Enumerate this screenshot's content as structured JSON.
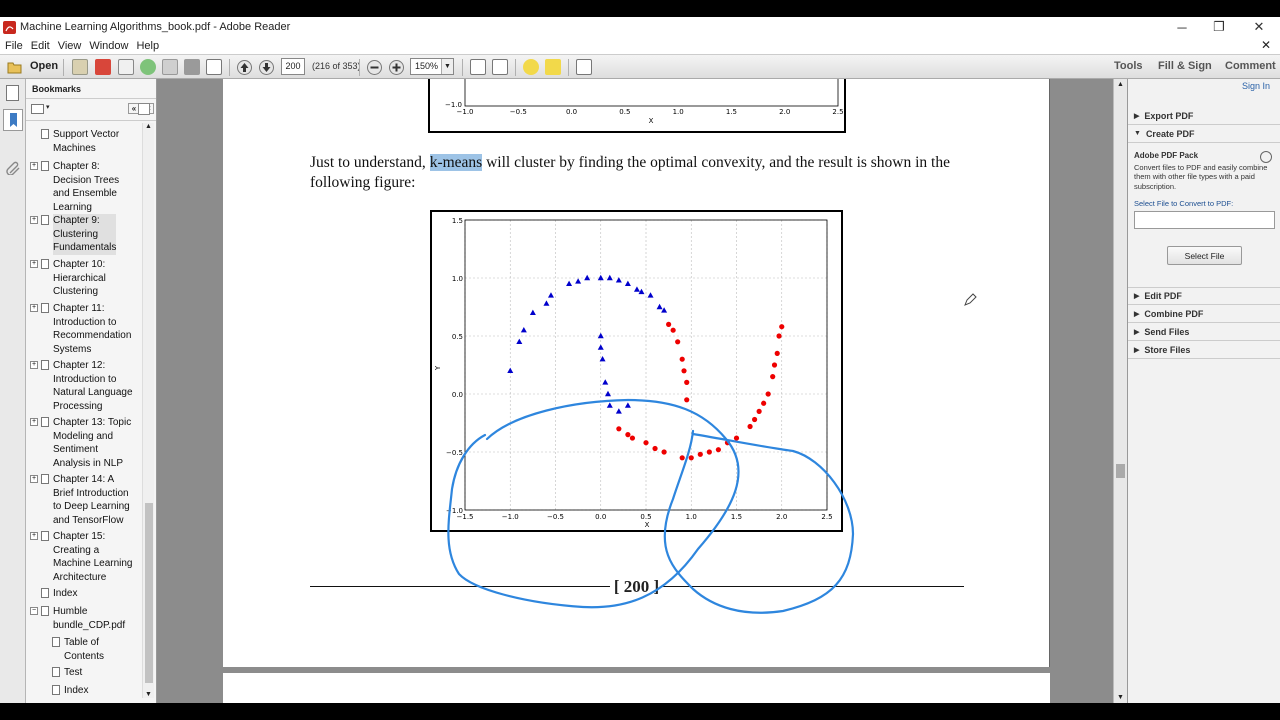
{
  "window": {
    "title": "Machine Learning Algorithms_book.pdf - Adobe Reader",
    "minimize": "─",
    "restore": "❐",
    "close": "✕"
  },
  "menu": {
    "items": [
      "File",
      "Edit",
      "View",
      "Window",
      "Help"
    ],
    "close_doc": "✕"
  },
  "toolbar": {
    "open_label": "Open",
    "page_value": "200",
    "page_count": "(216 of 353)",
    "zoom_value": "150%",
    "tools_label": "Tools",
    "fillsign_label": "Fill & Sign",
    "comment_label": "Comment"
  },
  "bookmarks": {
    "header": "Bookmarks",
    "items": [
      {
        "label": "Support Vector\nMachines",
        "expander": "",
        "selected": false
      },
      {
        "label": "Chapter 8:\nDecision Trees\nand Ensemble\nLearning",
        "expander": "+",
        "selected": false
      },
      {
        "label": "Chapter 9:\nClustering\nFundamentals",
        "expander": "+",
        "selected": true
      },
      {
        "label": "Chapter 10:\nHierarchical\nClustering",
        "expander": "+",
        "selected": false
      },
      {
        "label": "Chapter 11:\nIntroduction to\nRecommendation\nSystems",
        "expander": "+",
        "selected": false
      },
      {
        "label": "Chapter 12:\nIntroduction to\nNatural Language\nProcessing",
        "expander": "+",
        "selected": false
      },
      {
        "label": "Chapter 13: Topic\nModeling and\nSentiment\nAnalysis in NLP",
        "expander": "+",
        "selected": false
      },
      {
        "label": "Chapter 14: A\nBrief Introduction\nto Deep Learning\nand TensorFlow",
        "expander": "+",
        "selected": false
      },
      {
        "label": "Chapter 15:\nCreating a\nMachine Learning\nArchitecture",
        "expander": "+",
        "selected": false
      },
      {
        "label": "Index",
        "expander": "",
        "selected": false
      },
      {
        "label": "Humble\nbundle_CDP.pdf",
        "expander": "−",
        "selected": false
      },
      {
        "label": "Table of\nContents",
        "expander": "",
        "selected": false
      },
      {
        "label": "Test",
        "expander": "",
        "selected": false
      },
      {
        "label": "Index",
        "expander": "",
        "selected": false
      }
    ]
  },
  "document": {
    "para_before": "Just to understand, ",
    "para_highlight": "k-means",
    "para_after": " will cluster by finding the optimal convexity, and the result is shown in the following figure:",
    "page_number": "[ 200 ]"
  },
  "top_figure": {
    "xticks": [
      "−1.0",
      "−0.5",
      "0.0",
      "0.5",
      "1.0",
      "1.5",
      "2.0",
      "2.5"
    ],
    "ytick": "−1.0",
    "xlabel": "X"
  },
  "chart_data": {
    "type": "scatter",
    "xlabel": "X",
    "ylabel": "Y",
    "xlim": [
      -1.5,
      2.5
    ],
    "ylim": [
      -1.0,
      1.5
    ],
    "xticks": [
      "−1.5",
      "−1.0",
      "−0.5",
      "0.0",
      "0.5",
      "1.0",
      "1.5",
      "2.0",
      "2.5"
    ],
    "yticks": [
      "1.5",
      "1.0",
      "0.5",
      "0.0",
      "−0.5",
      "−1.0"
    ],
    "grid": true,
    "series": [
      {
        "color": "#0000cc",
        "marker": "triangle",
        "points": [
          [
            -1.0,
            0.2
          ],
          [
            -0.9,
            0.45
          ],
          [
            -0.75,
            0.7
          ],
          [
            -0.55,
            0.85
          ],
          [
            -0.35,
            0.95
          ],
          [
            -0.15,
            1.0
          ],
          [
            0.0,
            1.0
          ],
          [
            0.2,
            0.98
          ],
          [
            0.4,
            0.9
          ],
          [
            0.55,
            0.85
          ],
          [
            0.7,
            0.72
          ],
          [
            -0.85,
            0.55
          ],
          [
            -0.6,
            0.78
          ],
          [
            -0.25,
            0.97
          ],
          [
            0.1,
            1.0
          ],
          [
            0.3,
            0.95
          ],
          [
            0.45,
            0.88
          ],
          [
            0.65,
            0.75
          ],
          [
            0.0,
            0.5
          ],
          [
            0.02,
            0.3
          ],
          [
            0.05,
            0.1
          ],
          [
            0.1,
            -0.1
          ],
          [
            0.2,
            -0.15
          ],
          [
            0.3,
            -0.1
          ],
          [
            0.0,
            0.4
          ],
          [
            0.08,
            0.0
          ]
        ]
      },
      {
        "color": "#ee0000",
        "marker": "circle",
        "points": [
          [
            0.75,
            0.6
          ],
          [
            0.85,
            0.45
          ],
          [
            0.9,
            0.3
          ],
          [
            0.95,
            0.1
          ],
          [
            0.95,
            -0.05
          ],
          [
            0.2,
            -0.3
          ],
          [
            0.35,
            -0.38
          ],
          [
            0.5,
            -0.42
          ],
          [
            0.7,
            -0.5
          ],
          [
            0.9,
            -0.55
          ],
          [
            1.1,
            -0.52
          ],
          [
            1.3,
            -0.48
          ],
          [
            1.5,
            -0.38
          ],
          [
            1.65,
            -0.28
          ],
          [
            1.75,
            -0.15
          ],
          [
            1.85,
            0.0
          ],
          [
            1.9,
            0.15
          ],
          [
            1.95,
            0.35
          ],
          [
            1.97,
            0.5
          ],
          [
            2.0,
            0.58
          ],
          [
            0.8,
            0.55
          ],
          [
            0.92,
            0.2
          ],
          [
            0.3,
            -0.35
          ],
          [
            0.6,
            -0.47
          ],
          [
            1.0,
            -0.55
          ],
          [
            1.2,
            -0.5
          ],
          [
            1.4,
            -0.42
          ],
          [
            1.7,
            -0.22
          ],
          [
            1.8,
            -0.08
          ],
          [
            1.92,
            0.25
          ]
        ]
      }
    ]
  },
  "right_panel": {
    "signin": "Sign In",
    "export_pdf": "Export PDF",
    "create_pdf": "Create PDF",
    "pack_title": "Adobe PDF Pack",
    "pack_desc": "Convert files to PDF and easily combine them with other file types with a paid subscription.",
    "select_label": "Select File to Convert to PDF:",
    "select_button": "Select File",
    "edit_pdf": "Edit PDF",
    "combine_pdf": "Combine PDF",
    "send_files": "Send Files",
    "store_files": "Store Files"
  }
}
